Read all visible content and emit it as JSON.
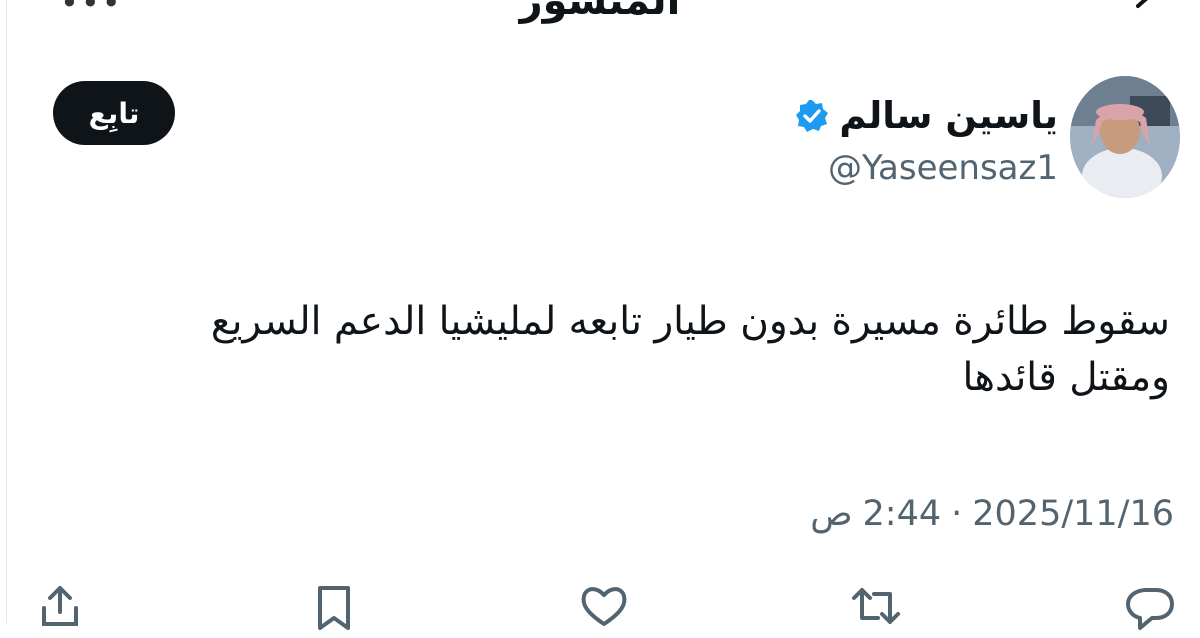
{
  "header": {
    "title": "المنشور",
    "back_icon": "arrow-back-icon",
    "more_icon": "more-icon"
  },
  "author": {
    "name": "ياسين سالم",
    "handle": "@Yaseensaz1",
    "verified_icon": "verified-badge-icon"
  },
  "follow_button": {
    "label": "تابِع"
  },
  "tweet": {
    "lines": [
      "سقوط طائرة مسيرة بدون طيار تابعه لمليشيا الدعم السريع",
      "ومقتل قائدها"
    ]
  },
  "timestamp": {
    "date": "2025/11/16",
    "separator": "·",
    "time": "2:44",
    "period": "ص"
  },
  "actions": [
    {
      "name": "reply-icon"
    },
    {
      "name": "retweet-icon"
    },
    {
      "name": "like-icon"
    },
    {
      "name": "bookmark-icon"
    },
    {
      "name": "share-icon"
    }
  ],
  "colors": {
    "text": "#0f1419",
    "secondary": "#536471",
    "verified": "#1d9bf0",
    "button_bg": "#0f1419"
  }
}
